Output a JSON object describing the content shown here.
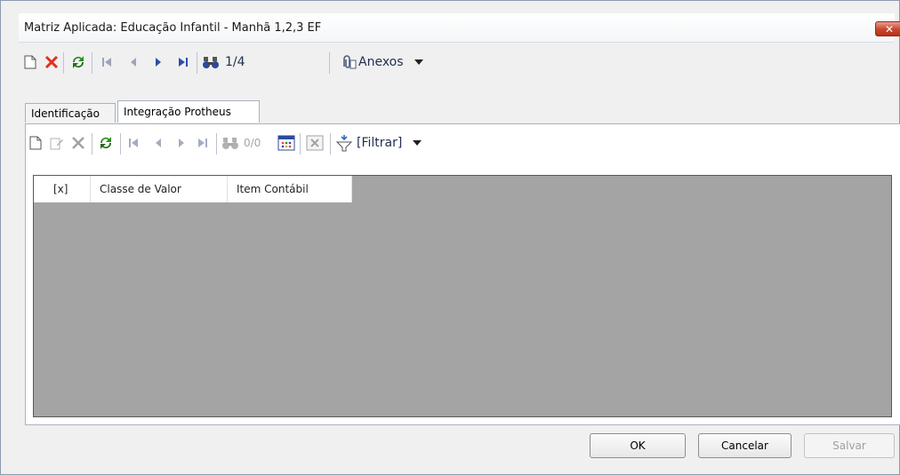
{
  "window": {
    "title": "Matriz Aplicada: Educação Infantil - Manhã 1,2,3 EF",
    "close_label": "✕"
  },
  "toolbar": {
    "record_position": "1/4",
    "attachments_label": "Anexos"
  },
  "tabs": [
    {
      "label": "Identificação",
      "active": false
    },
    {
      "label": "Integração Protheus",
      "active": true
    }
  ],
  "subtoolbar": {
    "record_position": "0/0",
    "filter_label": "[Filtrar]"
  },
  "grid": {
    "columns": [
      "[x]",
      "Classe de Valor",
      "Item Contábil"
    ]
  },
  "footer": {
    "ok_label": "OK",
    "cancel_label": "Cancelar",
    "save_label": "Salvar"
  },
  "colors": {
    "grid_background": "#a4a4a4",
    "close_button": "#c9452d",
    "refresh_green": "#2e8b22"
  }
}
